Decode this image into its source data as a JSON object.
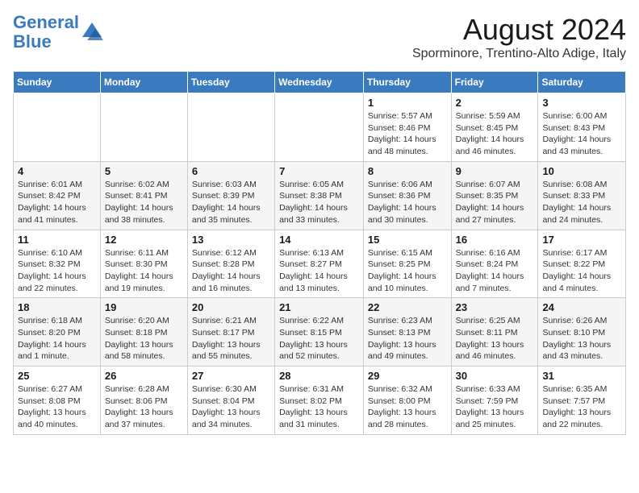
{
  "logo": {
    "line1": "General",
    "line2": "Blue"
  },
  "title": {
    "month_year": "August 2024",
    "location": "Sporminore, Trentino-Alto Adige, Italy"
  },
  "weekdays": [
    "Sunday",
    "Monday",
    "Tuesday",
    "Wednesday",
    "Thursday",
    "Friday",
    "Saturday"
  ],
  "weeks": [
    [
      {
        "day": "",
        "info": ""
      },
      {
        "day": "",
        "info": ""
      },
      {
        "day": "",
        "info": ""
      },
      {
        "day": "",
        "info": ""
      },
      {
        "day": "1",
        "info": "Sunrise: 5:57 AM\nSunset: 8:46 PM\nDaylight: 14 hours and 48 minutes."
      },
      {
        "day": "2",
        "info": "Sunrise: 5:59 AM\nSunset: 8:45 PM\nDaylight: 14 hours and 46 minutes."
      },
      {
        "day": "3",
        "info": "Sunrise: 6:00 AM\nSunset: 8:43 PM\nDaylight: 14 hours and 43 minutes."
      }
    ],
    [
      {
        "day": "4",
        "info": "Sunrise: 6:01 AM\nSunset: 8:42 PM\nDaylight: 14 hours and 41 minutes."
      },
      {
        "day": "5",
        "info": "Sunrise: 6:02 AM\nSunset: 8:41 PM\nDaylight: 14 hours and 38 minutes."
      },
      {
        "day": "6",
        "info": "Sunrise: 6:03 AM\nSunset: 8:39 PM\nDaylight: 14 hours and 35 minutes."
      },
      {
        "day": "7",
        "info": "Sunrise: 6:05 AM\nSunset: 8:38 PM\nDaylight: 14 hours and 33 minutes."
      },
      {
        "day": "8",
        "info": "Sunrise: 6:06 AM\nSunset: 8:36 PM\nDaylight: 14 hours and 30 minutes."
      },
      {
        "day": "9",
        "info": "Sunrise: 6:07 AM\nSunset: 8:35 PM\nDaylight: 14 hours and 27 minutes."
      },
      {
        "day": "10",
        "info": "Sunrise: 6:08 AM\nSunset: 8:33 PM\nDaylight: 14 hours and 24 minutes."
      }
    ],
    [
      {
        "day": "11",
        "info": "Sunrise: 6:10 AM\nSunset: 8:32 PM\nDaylight: 14 hours and 22 minutes."
      },
      {
        "day": "12",
        "info": "Sunrise: 6:11 AM\nSunset: 8:30 PM\nDaylight: 14 hours and 19 minutes."
      },
      {
        "day": "13",
        "info": "Sunrise: 6:12 AM\nSunset: 8:28 PM\nDaylight: 14 hours and 16 minutes."
      },
      {
        "day": "14",
        "info": "Sunrise: 6:13 AM\nSunset: 8:27 PM\nDaylight: 14 hours and 13 minutes."
      },
      {
        "day": "15",
        "info": "Sunrise: 6:15 AM\nSunset: 8:25 PM\nDaylight: 14 hours and 10 minutes."
      },
      {
        "day": "16",
        "info": "Sunrise: 6:16 AM\nSunset: 8:24 PM\nDaylight: 14 hours and 7 minutes."
      },
      {
        "day": "17",
        "info": "Sunrise: 6:17 AM\nSunset: 8:22 PM\nDaylight: 14 hours and 4 minutes."
      }
    ],
    [
      {
        "day": "18",
        "info": "Sunrise: 6:18 AM\nSunset: 8:20 PM\nDaylight: 14 hours and 1 minute."
      },
      {
        "day": "19",
        "info": "Sunrise: 6:20 AM\nSunset: 8:18 PM\nDaylight: 13 hours and 58 minutes."
      },
      {
        "day": "20",
        "info": "Sunrise: 6:21 AM\nSunset: 8:17 PM\nDaylight: 13 hours and 55 minutes."
      },
      {
        "day": "21",
        "info": "Sunrise: 6:22 AM\nSunset: 8:15 PM\nDaylight: 13 hours and 52 minutes."
      },
      {
        "day": "22",
        "info": "Sunrise: 6:23 AM\nSunset: 8:13 PM\nDaylight: 13 hours and 49 minutes."
      },
      {
        "day": "23",
        "info": "Sunrise: 6:25 AM\nSunset: 8:11 PM\nDaylight: 13 hours and 46 minutes."
      },
      {
        "day": "24",
        "info": "Sunrise: 6:26 AM\nSunset: 8:10 PM\nDaylight: 13 hours and 43 minutes."
      }
    ],
    [
      {
        "day": "25",
        "info": "Sunrise: 6:27 AM\nSunset: 8:08 PM\nDaylight: 13 hours and 40 minutes."
      },
      {
        "day": "26",
        "info": "Sunrise: 6:28 AM\nSunset: 8:06 PM\nDaylight: 13 hours and 37 minutes."
      },
      {
        "day": "27",
        "info": "Sunrise: 6:30 AM\nSunset: 8:04 PM\nDaylight: 13 hours and 34 minutes."
      },
      {
        "day": "28",
        "info": "Sunrise: 6:31 AM\nSunset: 8:02 PM\nDaylight: 13 hours and 31 minutes."
      },
      {
        "day": "29",
        "info": "Sunrise: 6:32 AM\nSunset: 8:00 PM\nDaylight: 13 hours and 28 minutes."
      },
      {
        "day": "30",
        "info": "Sunrise: 6:33 AM\nSunset: 7:59 PM\nDaylight: 13 hours and 25 minutes."
      },
      {
        "day": "31",
        "info": "Sunrise: 6:35 AM\nSunset: 7:57 PM\nDaylight: 13 hours and 22 minutes."
      }
    ]
  ]
}
